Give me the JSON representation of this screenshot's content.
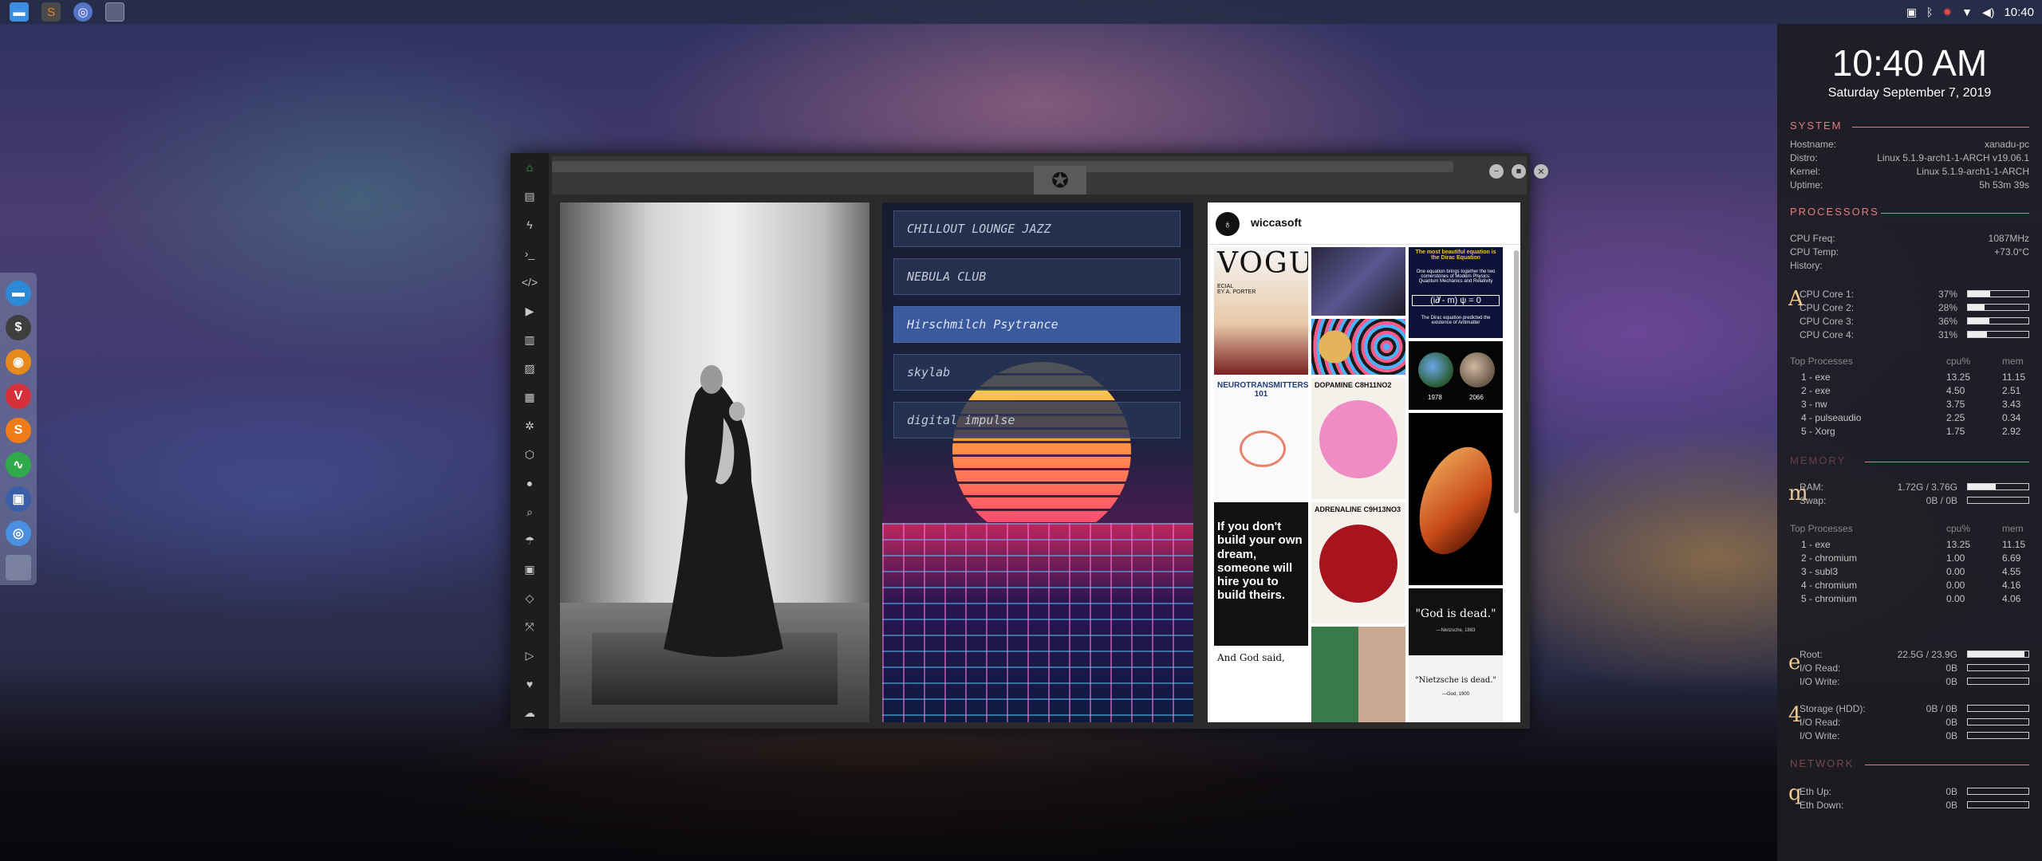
{
  "topbar": {
    "launchers": [
      "file-manager-icon",
      "sublime-text-icon",
      "chromium-icon",
      "workspace-icon"
    ],
    "tray_icons": [
      "screenshot-icon",
      "bluetooth-icon",
      "settings-icon",
      "wifi-icon",
      "volume-icon"
    ],
    "time": "10:40"
  },
  "dock": {
    "apps": [
      {
        "name": "files-dock-icon",
        "glyph": "▬",
        "color": "#2d88d6"
      },
      {
        "name": "terminal-dock-icon",
        "glyph": "$",
        "color": "#3e3e3e"
      },
      {
        "name": "ubuntu-dock-icon",
        "glyph": "◉",
        "color": "#e88a1a"
      },
      {
        "name": "vivaldi-dock-icon",
        "glyph": "V",
        "color": "#d6303a"
      },
      {
        "name": "sublime-dock-icon",
        "glyph": "S",
        "color": "#f07c17"
      },
      {
        "name": "system-monitor-dock-icon",
        "glyph": "∿",
        "color": "#2fa94a"
      },
      {
        "name": "screen-dock-icon",
        "glyph": "▣",
        "color": "#3a5ea8"
      },
      {
        "name": "chromium-dock-icon",
        "glyph": "◎",
        "color": "#4a8fe0"
      }
    ]
  },
  "window": {
    "emblem": "✪",
    "controls": [
      "−",
      "■",
      "✕"
    ],
    "sidebar_icons": [
      "home-icon",
      "document-icon",
      "bolt-icon",
      "terminal-icon",
      "code-icon",
      "play-icon",
      "book-icon",
      "image-icon",
      "news-icon",
      "settings-icon",
      "hexagon-icon",
      "globe-icon",
      "search-icon",
      "umbrella-icon",
      "contact-icon",
      "code-brackets-icon",
      "expand-icon",
      "youtube-icon",
      "heart-icon",
      "cloud-icon"
    ]
  },
  "music": {
    "stations": [
      {
        "label": "CHILLOUT LOUNGE JAZZ",
        "active": false
      },
      {
        "label": "NEBULA CLUB",
        "active": false
      },
      {
        "label": "Hirschmilch Psytrance",
        "active": true
      },
      {
        "label": "skylab",
        "active": false
      },
      {
        "label": "digital impulse",
        "active": false
      }
    ]
  },
  "instagram": {
    "username": "wiccasoft",
    "tiles": {
      "vogue": "VOGUE",
      "vogue_side": "ECIAL\nEY A. PORTER",
      "dirac_title": "The most beautiful equation is the Dirac Equation",
      "dirac_body": "One equation brings together the two cornerstones of Modern Physics: Quantum Mechanics and Relativity",
      "dirac_eq": "(i∂̸ - m) ψ = 0",
      "dirac_foot": "The Dirac equation predicted the existence of Antimatter",
      "neuro": "NEUROTRANSMITTERS 101",
      "dopamine": "DOPAMINE  C8H11NO2",
      "adrenaline": "ADRENALINE  C9H13NO3",
      "planet_1978": "1978",
      "planet_2066": "2066",
      "quote": "If you don't build your own dream, someone will hire you to build theirs.",
      "and_god": "And God said,",
      "god_dead": "\"God is dead.\"",
      "god_dead_attr": "—Nietzsche, 1883",
      "nietzsche_dead": "\"Nietzsche is dead.\"",
      "nietzsche_dead_attr": "—God, 1900"
    }
  },
  "conky": {
    "time": "10:40 AM",
    "date": "Saturday September  7, 2019",
    "system": {
      "title": "SYSTEM",
      "rows": [
        {
          "k": "Hostname:",
          "v": "xanadu-pc"
        },
        {
          "k": "Distro:",
          "v": "Linux 5.1.9-arch1-1-ARCH v19.06.1"
        },
        {
          "k": "Kernel:",
          "v": "Linux 5.1.9-arch1-1-ARCH"
        },
        {
          "k": "Uptime:",
          "v": "5h 53m 39s"
        }
      ]
    },
    "processors": {
      "title": "PROCESSORS",
      "rows": [
        {
          "k": "CPU Freq:",
          "v": "1087MHz"
        },
        {
          "k": "CPU Temp:",
          "v": "+73.0°C"
        },
        {
          "k": "History:",
          "v": ""
        }
      ],
      "letter": "A",
      "cores": [
        {
          "k": "CPU Core 1:",
          "v": "37%",
          "pct": 0.37
        },
        {
          "k": "CPU Core 2:",
          "v": "28%",
          "pct": 0.28
        },
        {
          "k": "CPU Core 3:",
          "v": "36%",
          "pct": 0.36
        },
        {
          "k": "CPU Core 4:",
          "v": "31%",
          "pct": 0.31
        }
      ],
      "top_title": "Top Processes",
      "col_cpu": "cpu%",
      "col_mem": "mem",
      "procs": [
        {
          "n": "1 - exe",
          "cpu": "13.25",
          "mem": "11.15"
        },
        {
          "n": "2 - exe",
          "cpu": "4.50",
          "mem": "2.51"
        },
        {
          "n": "3 - nw",
          "cpu": "3.75",
          "mem": "3.43"
        },
        {
          "n": "4 - pulseaudio",
          "cpu": "2.25",
          "mem": "0.34"
        },
        {
          "n": "5 - Xorg",
          "cpu": "1.75",
          "mem": "2.92"
        }
      ]
    },
    "memory": {
      "title": "MEMORY",
      "letter": "m",
      "rows": [
        {
          "k": "RAM:",
          "v": "1.72G / 3.76G",
          "pct": 0.46
        },
        {
          "k": "Swap:",
          "v": "0B / 0B",
          "pct": 0
        }
      ],
      "top_title": "Top Processes",
      "col_cpu": "cpu%",
      "col_mem": "mem",
      "procs": [
        {
          "n": "1 - exe",
          "cpu": "13.25",
          "mem": "11.15"
        },
        {
          "n": "2 - chromium",
          "cpu": "1.00",
          "mem": "6.69"
        },
        {
          "n": "3 - subl3",
          "cpu": "0.00",
          "mem": "4.55"
        },
        {
          "n": "4 - chromium",
          "cpu": "0.00",
          "mem": "4.16"
        },
        {
          "n": "5 - chromium",
          "cpu": "0.00",
          "mem": "4.06"
        }
      ]
    },
    "drives": {
      "letter": "e",
      "rows": [
        {
          "k": "Root:",
          "v": "22.5G / 23.9G",
          "pct": 0.94
        },
        {
          "k": "I/O Read:",
          "v": "0B",
          "pct": 0
        },
        {
          "k": "I/O Write:",
          "v": "0B",
          "pct": 0
        }
      ]
    },
    "storage": {
      "letter": "4",
      "rows": [
        {
          "k": "Storage (HDD):",
          "v": "0B / 0B",
          "pct": 0
        },
        {
          "k": "I/O Read:",
          "v": "0B",
          "pct": 0
        },
        {
          "k": "I/O Write:",
          "v": "0B",
          "pct": 0
        }
      ]
    },
    "network": {
      "title": "NETWORK",
      "letter": "q",
      "rows": [
        {
          "k": "Eth Up:",
          "v": "0B",
          "pct": 0
        },
        {
          "k": "Eth Down:",
          "v": "0B",
          "pct": 0
        }
      ]
    }
  }
}
